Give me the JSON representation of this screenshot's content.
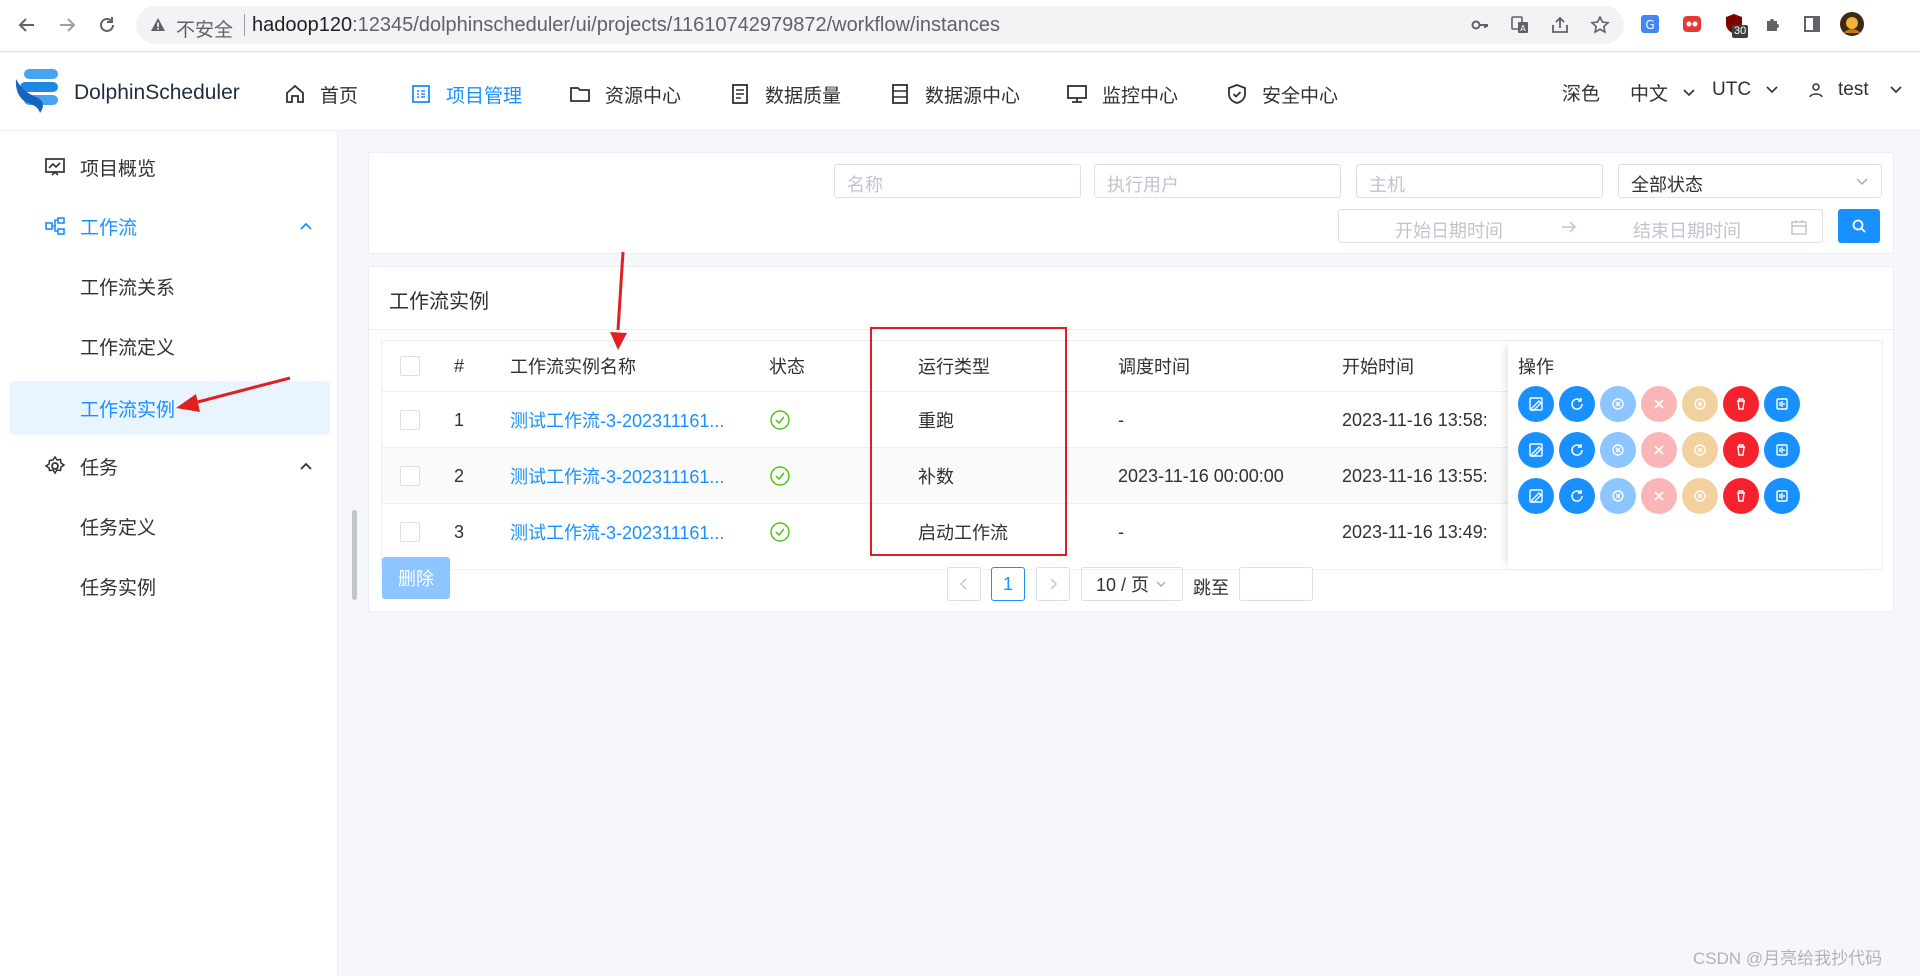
{
  "browser": {
    "security_label": "不安全",
    "url_host": "hadoop120",
    "url_rest": ":12345/dolphinscheduler/ui/projects/11610742979872/workflow/instances",
    "ext_badge": "30"
  },
  "app": {
    "logo_text": "DolphinScheduler",
    "menu": [
      {
        "label": "首页",
        "icon": "home-icon"
      },
      {
        "label": "项目管理",
        "icon": "project-icon",
        "active": true
      },
      {
        "label": "资源中心",
        "icon": "folder-icon"
      },
      {
        "label": "数据质量",
        "icon": "document-icon"
      },
      {
        "label": "数据源中心",
        "icon": "database-icon"
      },
      {
        "label": "监控中心",
        "icon": "monitor-icon"
      },
      {
        "label": "安全中心",
        "icon": "shield-icon"
      }
    ],
    "theme_label": "深色",
    "lang_label": "中文",
    "timezone_label": "UTC",
    "user_label": "test"
  },
  "sidebar": {
    "overview": "项目概览",
    "workflow": "工作流",
    "workflow_relation": "工作流关系",
    "workflow_definition": "工作流定义",
    "workflow_instance": "工作流实例",
    "task": "任务",
    "task_definition": "任务定义",
    "task_instance": "任务实例"
  },
  "filters": {
    "name_placeholder": "名称",
    "executor_placeholder": "执行用户",
    "host_placeholder": "主机",
    "state_value": "全部状态",
    "start_placeholder": "开始日期时间",
    "end_placeholder": "结束日期时间"
  },
  "table": {
    "title": "工作流实例",
    "headers": {
      "index": "#",
      "name": "工作流实例名称",
      "state": "状态",
      "run_type": "运行类型",
      "schedule_time": "调度时间",
      "start_time": "开始时间",
      "operation": "操作"
    },
    "rows": [
      {
        "index": "1",
        "name": "测试工作流-3-202311161...",
        "run_type": "重跑",
        "schedule_time": "-",
        "start_time": "2023-11-16 13:58:"
      },
      {
        "index": "2",
        "name": "测试工作流-3-202311161...",
        "run_type": "补数",
        "schedule_time": "2023-11-16 00:00:00",
        "start_time": "2023-11-16 13:55:"
      },
      {
        "index": "3",
        "name": "测试工作流-3-202311161...",
        "run_type": "启动工作流",
        "schedule_time": "-",
        "start_time": "2023-11-16 13:49:"
      }
    ],
    "delete_label": "删除"
  },
  "pagination": {
    "current": "1",
    "page_size": "10 / 页",
    "jump_label": "跳至"
  },
  "colors": {
    "primary": "#1890ff",
    "success": "#52c41a",
    "danger": "#f5222d",
    "warning": "#fadb14",
    "annotation": "#e02020"
  },
  "watermark": "CSDN @月亮给我抄代码"
}
